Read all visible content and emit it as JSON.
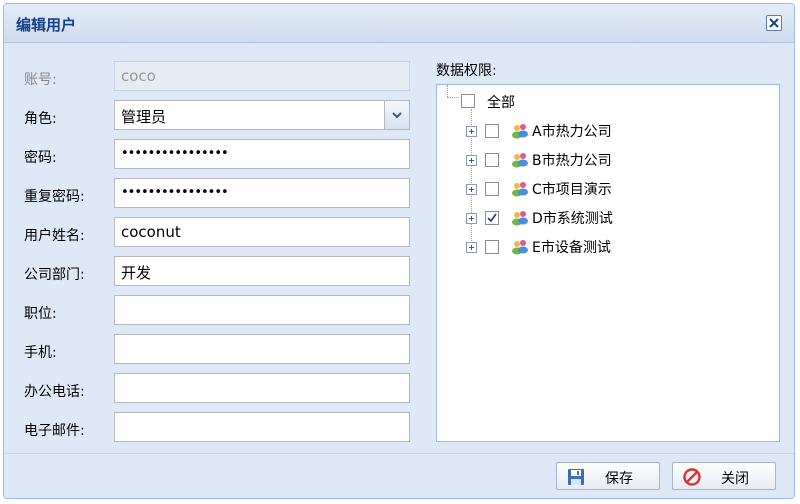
{
  "dialog": {
    "title": "编辑用户"
  },
  "form": {
    "account": {
      "label": "账号:",
      "value": "coco"
    },
    "role": {
      "label": "角色:",
      "value": "管理员"
    },
    "password": {
      "label": "密码:",
      "value": "••••••••••••••••"
    },
    "repeat_password": {
      "label": "重复密码:",
      "value": "••••••••••••••••"
    },
    "user_name": {
      "label": "用户姓名:",
      "value": "coconut"
    },
    "department": {
      "label": "公司部门:",
      "value": "开发"
    },
    "position": {
      "label": "职位:",
      "value": ""
    },
    "mobile": {
      "label": "手机:",
      "value": ""
    },
    "office_phone": {
      "label": "办公电话:",
      "value": ""
    },
    "email": {
      "label": "电子邮件:",
      "value": ""
    }
  },
  "permissions": {
    "label": "数据权限:",
    "root": {
      "label": "全部",
      "checked": false
    },
    "items": [
      {
        "label": "A市热力公司",
        "checked": false
      },
      {
        "label": "B市热力公司",
        "checked": false
      },
      {
        "label": "C市项目演示",
        "checked": false
      },
      {
        "label": "D市系统测试",
        "checked": true
      },
      {
        "label": "E市设备测试",
        "checked": false
      }
    ]
  },
  "buttons": {
    "save": "保存",
    "close": "关闭"
  },
  "colors": {
    "title": "#15428b",
    "window_bg": "#dfe8f6",
    "border": "#99bbe8"
  }
}
